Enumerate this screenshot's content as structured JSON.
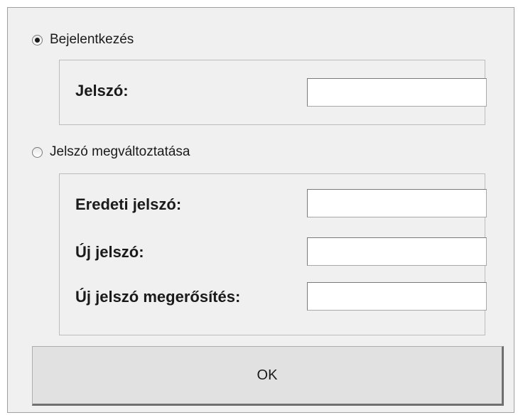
{
  "login_option": {
    "label": "Bejelentkezés",
    "selected": true,
    "password_label": "Jelszó:",
    "password_value": ""
  },
  "change_option": {
    "label": "Jelszó megváltoztatása",
    "selected": false,
    "original_password_label": "Eredeti jelszó:",
    "original_password_value": "",
    "new_password_label": "Új jelszó:",
    "new_password_value": "",
    "confirm_password_label": "Új jelszó megerősítés:",
    "confirm_password_value": ""
  },
  "ok_button": {
    "label": "OK"
  }
}
